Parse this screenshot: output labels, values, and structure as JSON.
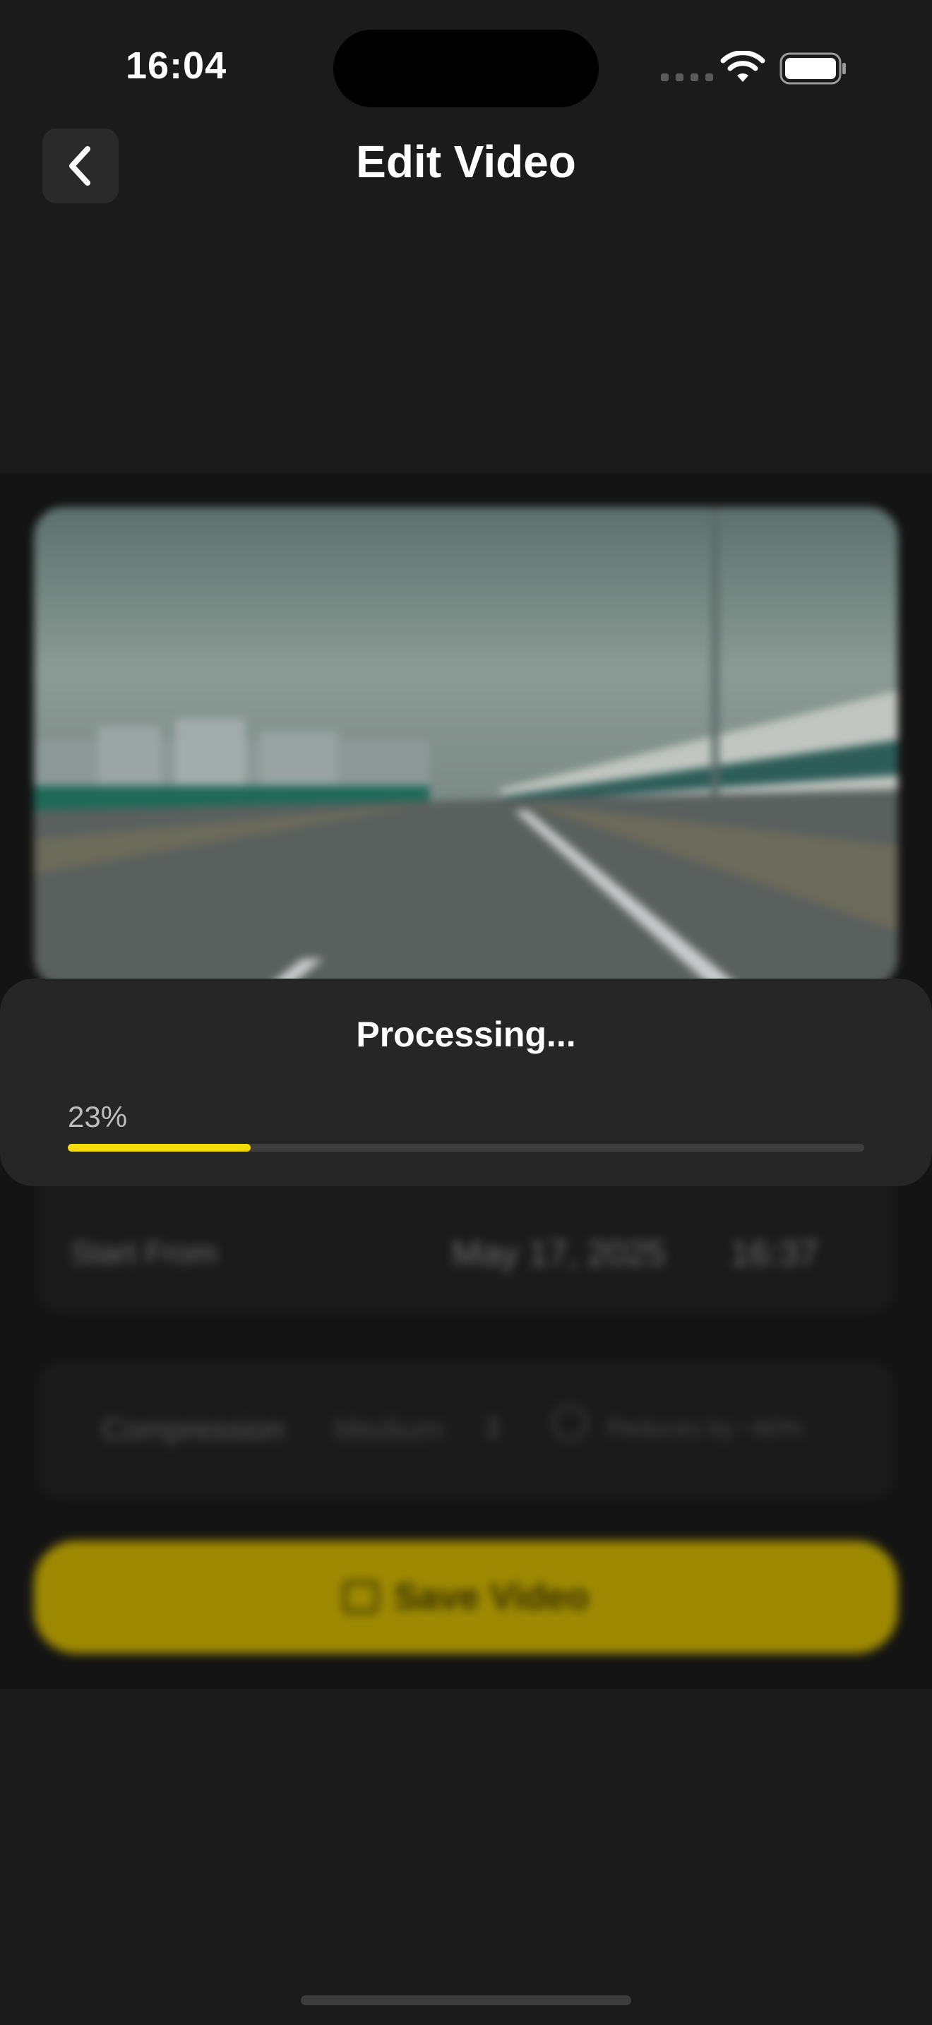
{
  "status_bar": {
    "time": "16:04"
  },
  "header": {
    "title": "Edit Video"
  },
  "start": {
    "label": "Start From",
    "date": "May 17, 2025",
    "time": "16:37"
  },
  "compression": {
    "label": "Compression",
    "value": "Medium",
    "reduction": "Reduces by ~60%"
  },
  "save_button": {
    "label": "Save Video"
  },
  "processing": {
    "title": "Processing...",
    "percent_label": "23%",
    "progress_fraction": 0.23
  },
  "colors": {
    "accent": "#f5d90a",
    "save_bg": "#b79f00",
    "background": "#1b1b1b"
  },
  "icons": {
    "back": "chevron-left-icon",
    "wifi": "wifi-icon",
    "battery": "battery-icon",
    "save": "save-icon"
  }
}
